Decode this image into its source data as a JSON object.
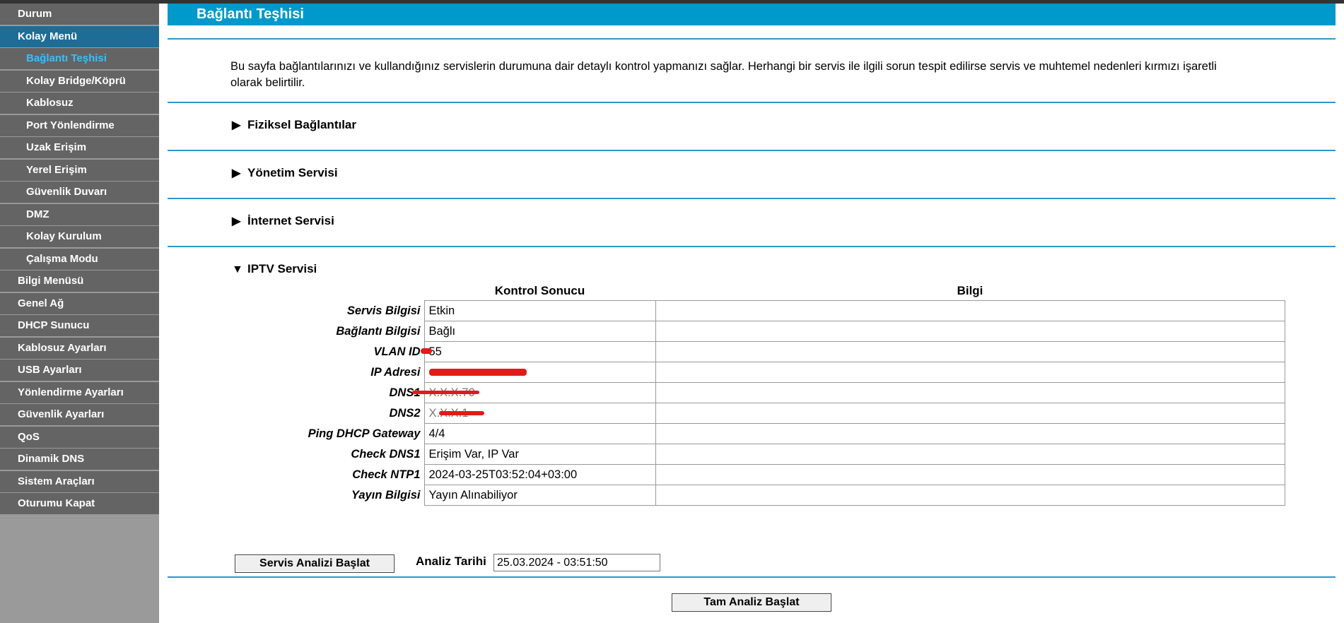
{
  "sidebar": {
    "items": [
      {
        "label": "Durum"
      },
      {
        "label": "Kolay Menü"
      },
      {
        "label": "Bağlantı Teşhisi"
      },
      {
        "label": "Kolay Bridge/Köprü"
      },
      {
        "label": "Kablosuz"
      },
      {
        "label": "Port Yönlendirme"
      },
      {
        "label": "Uzak Erişim"
      },
      {
        "label": "Yerel Erişim"
      },
      {
        "label": "Güvenlik Duvarı"
      },
      {
        "label": "DMZ"
      },
      {
        "label": "Kolay Kurulum"
      },
      {
        "label": "Çalışma Modu"
      },
      {
        "label": "Bilgi Menüsü"
      },
      {
        "label": "Genel Ağ"
      },
      {
        "label": "DHCP Sunucu"
      },
      {
        "label": "Kablosuz Ayarları"
      },
      {
        "label": "USB Ayarları"
      },
      {
        "label": "Yönlendirme Ayarları"
      },
      {
        "label": "Güvenlik Ayarları"
      },
      {
        "label": "QoS"
      },
      {
        "label": "Dinamik DNS"
      },
      {
        "label": "Sistem Araçları"
      },
      {
        "label": "Oturumu Kapat"
      }
    ],
    "active_color": "#33c1ff",
    "active_parent_color": "#1e6d97"
  },
  "page": {
    "title": "Bağlantı Teşhisi",
    "description": "Bu sayfa bağlantılarınızı ve kullandığınız servislerin durumuna dair detaylı kontrol yapmanızı sağlar. Herhangi bir servis ile ilgili sorun tespit edilirse servis ve muhtemel nedenleri kırmızı işaretli olarak belirtilir.",
    "accent_color": "#0099cc"
  },
  "sections": [
    {
      "label": "Fiziksel Bağlantılar",
      "arrow": "▶",
      "expanded": false
    },
    {
      "label": "Yönetim Servisi",
      "arrow": "▶",
      "expanded": false
    },
    {
      "label": "İnternet Servisi",
      "arrow": "▶",
      "expanded": false
    }
  ],
  "iptv": {
    "label": "IPTV Servisi",
    "arrow": "▼",
    "expanded": true,
    "col_result": "Kontrol Sonucu",
    "col_info": "Bilgi",
    "rows": [
      {
        "label": "Servis Bilgisi",
        "value": "Etkin",
        "info": ""
      },
      {
        "label": "Bağlantı Bilgisi",
        "value": "Bağlı",
        "info": ""
      },
      {
        "label": "VLAN ID",
        "value": "55",
        "info": "",
        "redacted": true
      },
      {
        "label": "IP Adresi",
        "value": "",
        "info": "",
        "redacted": true
      },
      {
        "label": "DNS1",
        "value": "X.X.X.70",
        "info": "",
        "redacted": true
      },
      {
        "label": "DNS2",
        "value": "X.X.X.1",
        "info": "",
        "redacted": true
      },
      {
        "label": "Ping DHCP Gateway",
        "value": "4/4",
        "info": ""
      },
      {
        "label": "Check DNS1",
        "value": "Erişim Var, IP Var",
        "info": ""
      },
      {
        "label": "Check NTP1",
        "value": "2024-03-25T03:52:04+03:00",
        "info": ""
      },
      {
        "label": "Yayın Bilgisi",
        "value": "Yayın Alınabiliyor",
        "info": ""
      }
    ],
    "start_button": "Servis Analizi Başlat",
    "date_label": "Analiz Tarihi",
    "date_value": "25.03.2024 - 03:51:50"
  },
  "full_analysis_button": "Tam Analiz Başlat",
  "redaction_color": "#e01b1b"
}
